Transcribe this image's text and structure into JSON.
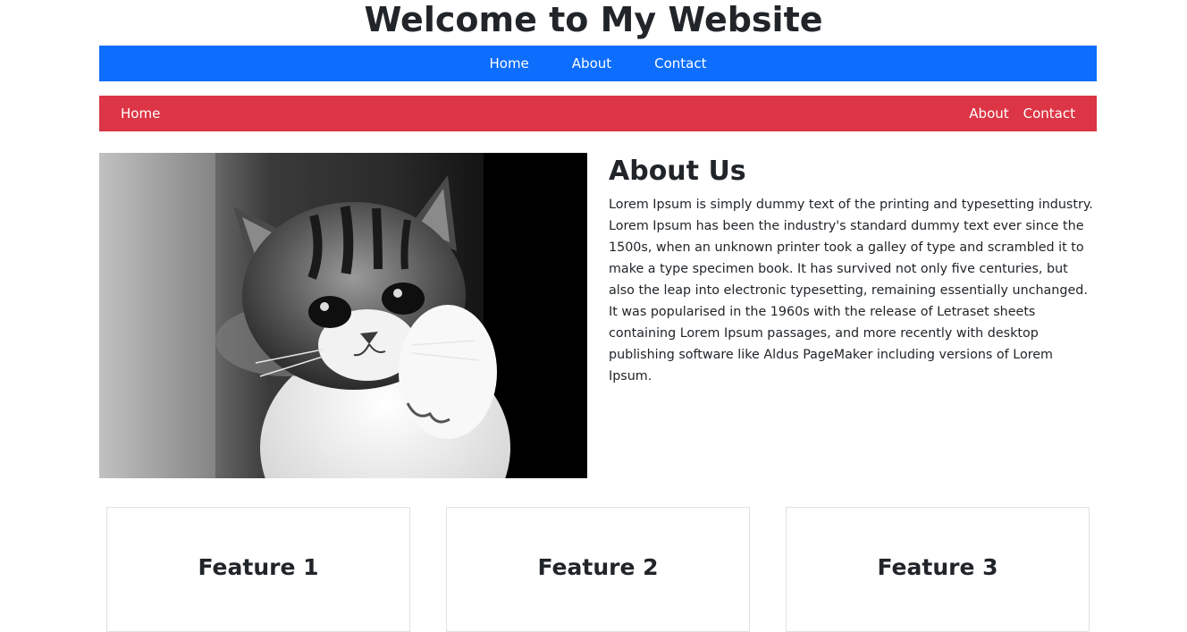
{
  "page": {
    "title": "Welcome to My Website"
  },
  "nav_primary": {
    "background": "#0d6efd",
    "items": [
      {
        "label": "Home"
      },
      {
        "label": "About"
      },
      {
        "label": "Contact"
      }
    ]
  },
  "nav_secondary": {
    "background": "#dc3545",
    "left_item": {
      "label": "Home"
    },
    "right_items": [
      {
        "label": "About"
      },
      {
        "label": "Contact"
      }
    ]
  },
  "hero": {
    "image": "kitten-photo"
  },
  "about": {
    "heading": "About Us",
    "body": "Lorem Ipsum is simply dummy text of the printing and typesetting industry. Lorem Ipsum has been the industry's standard dummy text ever since the 1500s, when an unknown printer took a galley of type and scrambled it to make a type specimen book. It has survived not only five centuries, but also the leap into electronic typesetting, remaining essentially unchanged. It was popularised in the 1960s with the release of Letraset sheets containing Lorem Ipsum passages, and more recently with desktop publishing software like Aldus PageMaker including versions of Lorem Ipsum."
  },
  "features": [
    {
      "title": "Feature 1"
    },
    {
      "title": "Feature 2"
    },
    {
      "title": "Feature 3"
    }
  ]
}
